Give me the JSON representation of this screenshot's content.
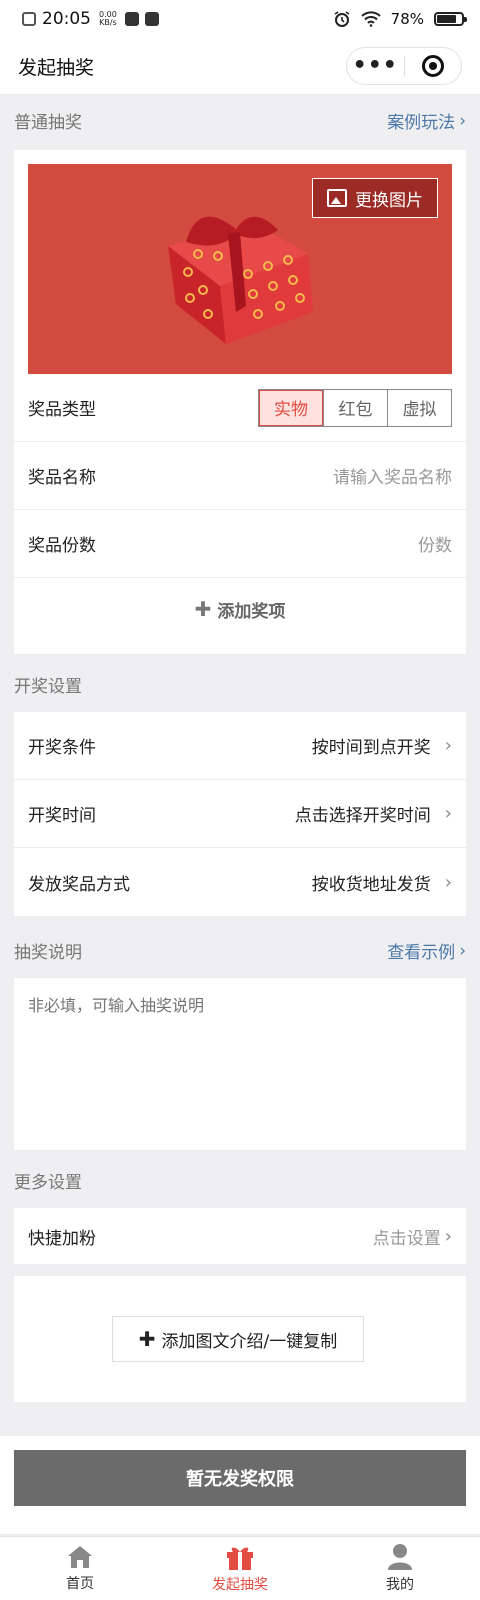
{
  "status_bar": {
    "time": "20:05",
    "speed_value": "0.00",
    "speed_unit": "KB/s",
    "battery": "78%",
    "battery_level": 0.78
  },
  "navbar": {
    "title": "发起抽奖",
    "menu_dots": "•••"
  },
  "normal_lottery": {
    "heading": "普通抽奖",
    "link": "案例玩法",
    "change_image": "更换图片",
    "prize_type_label": "奖品类型",
    "prize_types": [
      "实物",
      "红包",
      "虚拟"
    ],
    "selected_type": "实物",
    "prize_name_label": "奖品名称",
    "prize_name_placeholder": "请输入奖品名称",
    "prize_count_label": "奖品份数",
    "prize_count_placeholder": "份数",
    "add_prize": "添加奖项"
  },
  "draw_settings": {
    "heading": "开奖设置",
    "condition_label": "开奖条件",
    "condition_value": "按时间到点开奖",
    "time_label": "开奖时间",
    "time_value": "点击选择开奖时间",
    "delivery_label": "发放奖品方式",
    "delivery_value": "按收货地址发货"
  },
  "description": {
    "heading": "抽奖说明",
    "link": "查看示例",
    "placeholder": "非必填，可输入抽奖说明"
  },
  "more_settings": {
    "heading": "更多设置",
    "quick_follow_label": "快捷加粉",
    "quick_follow_value": "点击设置",
    "add_intro": "添加图文介绍/一键复制"
  },
  "footer": {
    "no_permission": "暂无发奖权限"
  },
  "tabbar": {
    "items": [
      "首页",
      "发起抽奖",
      "我的"
    ],
    "active": "发起抽奖"
  },
  "colors": {
    "accent": "#e24c42",
    "link": "#4d79a8",
    "banner": "#d34a3e"
  }
}
